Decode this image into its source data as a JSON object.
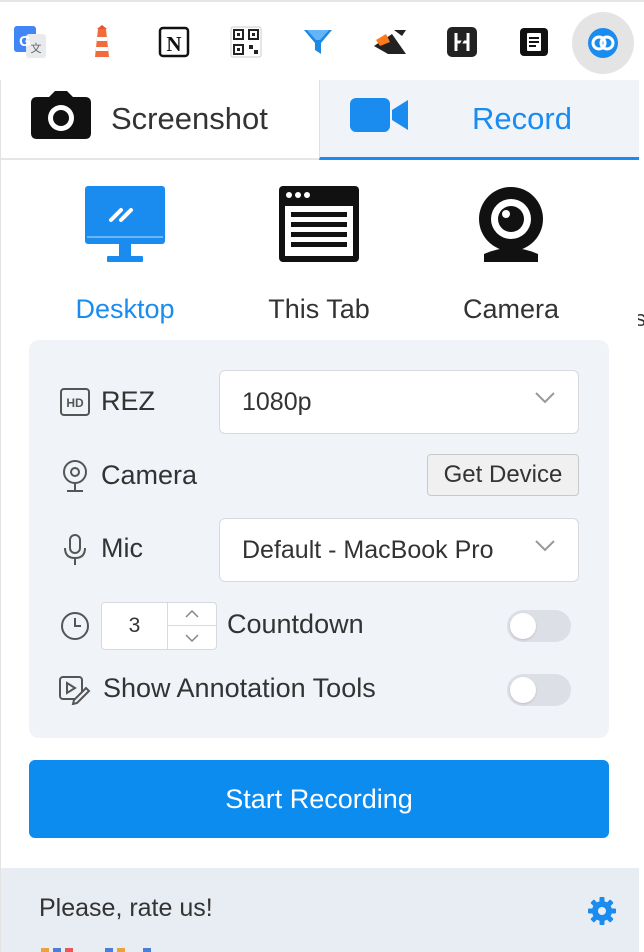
{
  "toolbar": {
    "extensions": [
      {
        "name": "google-translate-icon"
      },
      {
        "name": "lighthouse-icon"
      },
      {
        "name": "notion-icon"
      },
      {
        "name": "qr-code-icon"
      },
      {
        "name": "funnel-icon"
      },
      {
        "name": "video-capture-icon"
      },
      {
        "name": "hashnode-icon"
      },
      {
        "name": "note-icon"
      },
      {
        "name": "screen-recorder-extension-icon"
      }
    ]
  },
  "tabs": {
    "screenshot": "Screenshot",
    "record": "Record",
    "active": "record"
  },
  "modes": {
    "desktop": "Desktop",
    "this_tab": "This Tab",
    "camera": "Camera",
    "selected": "desktop"
  },
  "settings": {
    "rez": {
      "label": "REZ",
      "value": "1080p",
      "badge": "HD"
    },
    "camera": {
      "label": "Camera",
      "button": "Get Device"
    },
    "mic": {
      "label": "Mic",
      "value": "Default - MacBook Pro"
    },
    "countdown": {
      "label": "Countdown",
      "value": "3",
      "enabled": false
    },
    "annotation": {
      "label": "Show Annotation Tools",
      "enabled": false
    }
  },
  "start_button": "Start Recording",
  "footer": {
    "rate": "Please, rate us!"
  },
  "colors": {
    "accent": "#1a8cf0",
    "button": "#0d8cf0",
    "panel": "#f0f3f8",
    "text": "#333333"
  }
}
